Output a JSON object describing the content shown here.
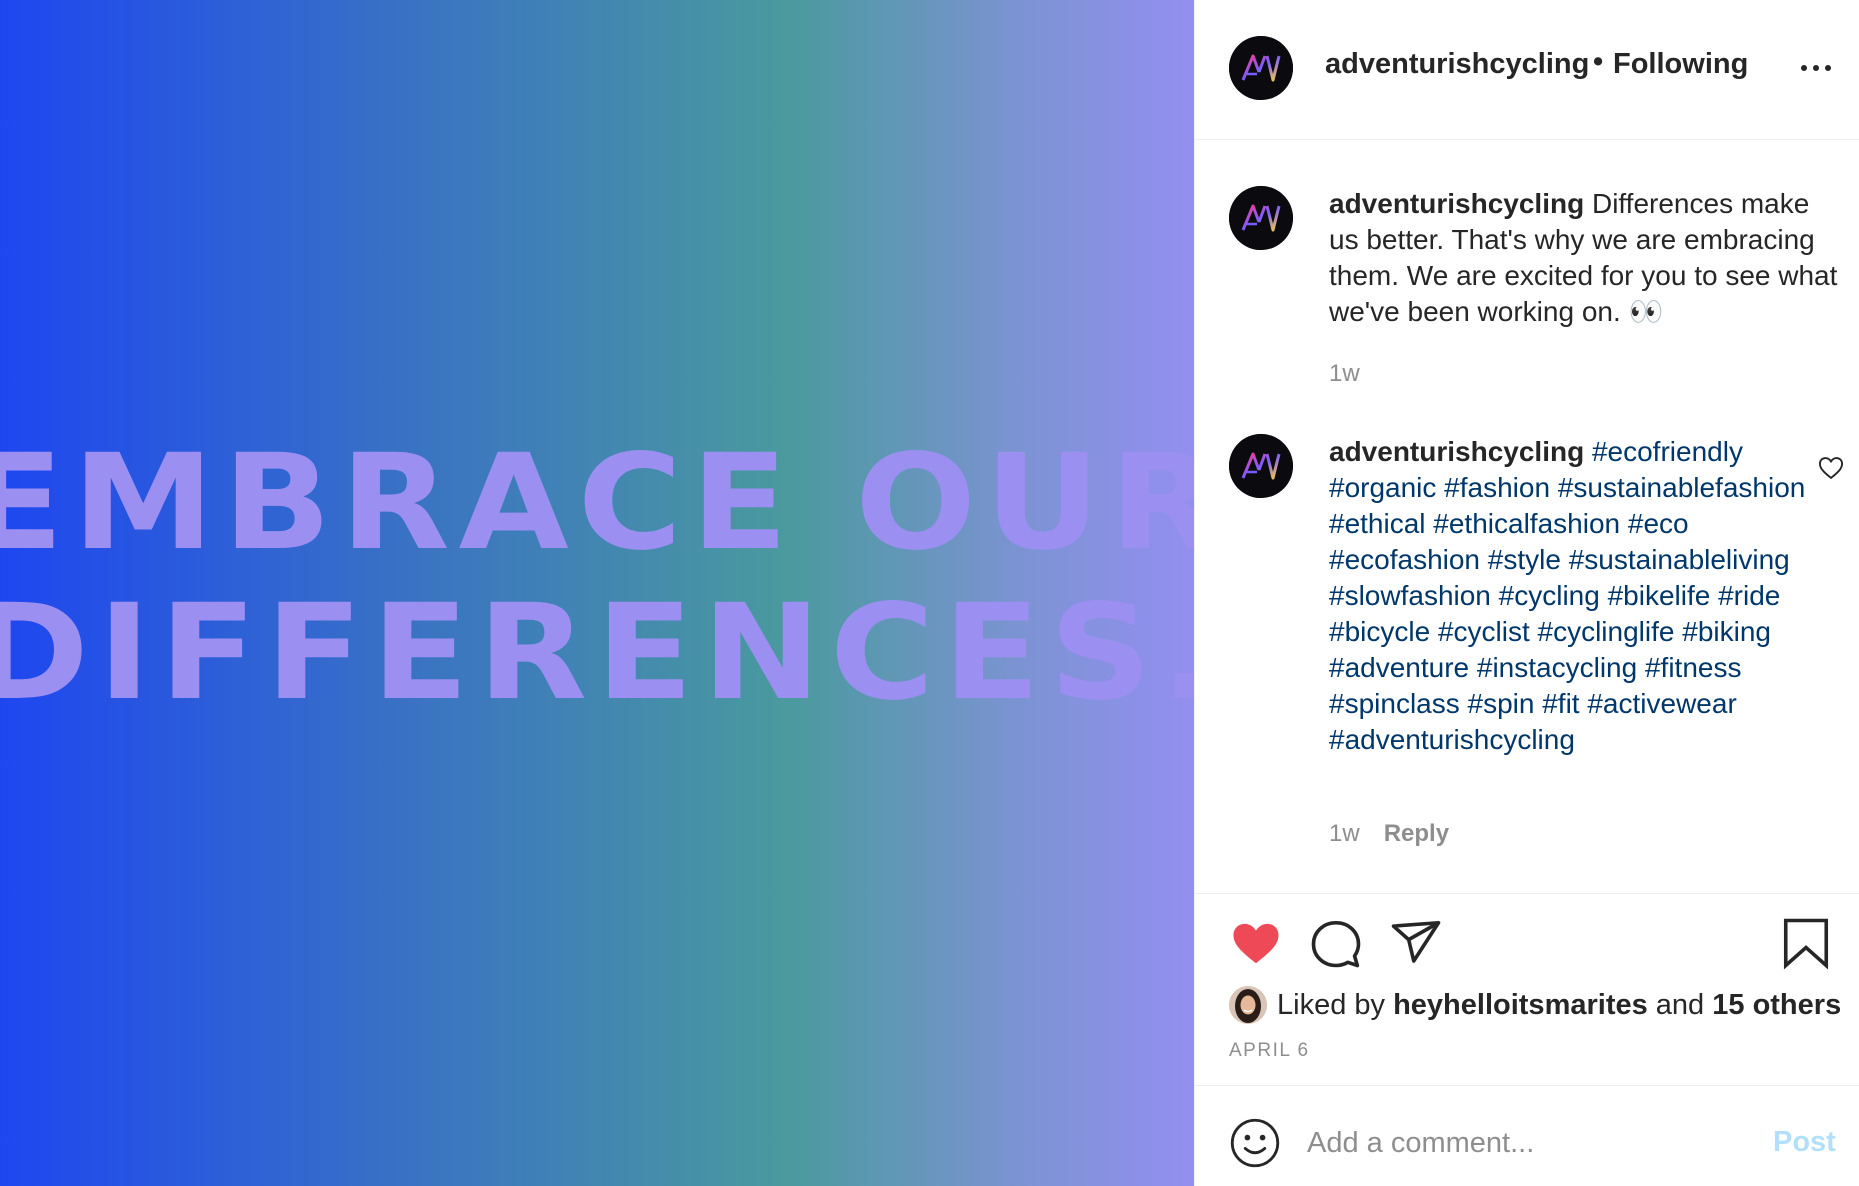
{
  "media": {
    "line1": "EMBRACE OUR",
    "line2": "DIFFERENCES.",
    "text_color": "#9b8ff2",
    "gradient": [
      "#1e47f0",
      "#4a9a9e",
      "#938ff0"
    ]
  },
  "header": {
    "username": "adventurishcycling",
    "separator": "•",
    "follow_status": "Following",
    "more_icon": "more-horizontal-icon"
  },
  "caption": {
    "username": "adventurishcycling",
    "text": "Differences make us better. That's why we are embracing them. We are excited for you to see what we've been working on. 👀",
    "time": "1w"
  },
  "comment": {
    "username": "adventurishcycling",
    "hashtags": "#ecofriendly #organic #fashion #sustainablefashion #ethical #ethicalfashion #eco #ecofashion #style #sustainableliving #slowfashion #cycling #bikelife #ride #bicycle #cyclist #cyclinglife #biking #adventure #instacycling #fitness #spinclass #spin #fit #activewear #adventurishcycling",
    "time": "1w",
    "reply_label": "Reply",
    "like_icon": "heart-outline-icon"
  },
  "actions": {
    "like_icon": "heart-filled-icon",
    "like_color": "#ed4956",
    "comment_icon": "comment-icon",
    "share_icon": "paper-plane-icon",
    "save_icon": "bookmark-icon"
  },
  "likes": {
    "prefix": "Liked by",
    "liker": "heyhelloitsmarites",
    "conjunction": "and",
    "others": "15 others"
  },
  "date": "APRIL 6",
  "comment_box": {
    "placeholder": "Add a comment...",
    "post_label": "Post",
    "post_color": "#b2dffc",
    "emoji_icon": "smiley-icon"
  }
}
